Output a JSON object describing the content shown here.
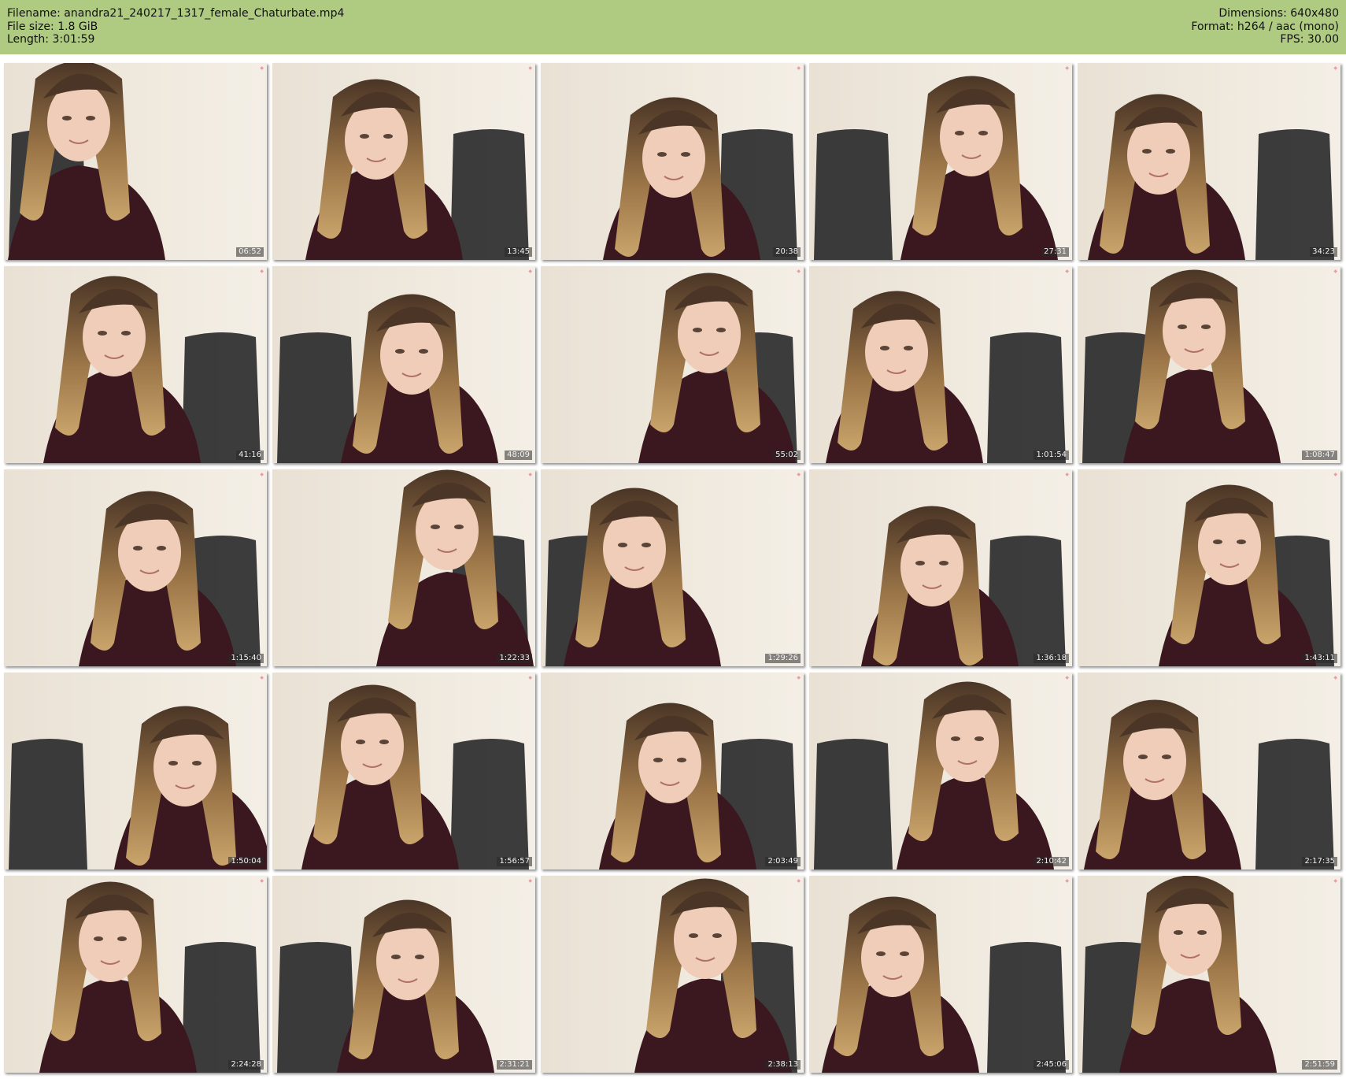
{
  "header": {
    "filename": "Filename: anandra21_240217_1317_female_Chaturbate.mp4",
    "filesize": "File size: 1.8 GiB",
    "length": "Length: 3:01:59",
    "dimensions": "Dimensions: 640x480",
    "format": "Format: h264 / aac (mono)",
    "fps": "FPS: 30.00"
  },
  "colors": {
    "header_bg": "#afcb82",
    "page_bg": "#ffffff"
  },
  "thumbnails": [
    {
      "timestamp": "06:52"
    },
    {
      "timestamp": "13:45"
    },
    {
      "timestamp": "20:38"
    },
    {
      "timestamp": "27:31"
    },
    {
      "timestamp": "34:23"
    },
    {
      "timestamp": "41:16"
    },
    {
      "timestamp": "48:09"
    },
    {
      "timestamp": "55:02"
    },
    {
      "timestamp": "1:01:54"
    },
    {
      "timestamp": "1:08:47"
    },
    {
      "timestamp": "1:15:40"
    },
    {
      "timestamp": "1:22:33"
    },
    {
      "timestamp": "1:29:26"
    },
    {
      "timestamp": "1:36:18"
    },
    {
      "timestamp": "1:43:11"
    },
    {
      "timestamp": "1:50:04"
    },
    {
      "timestamp": "1:56:57"
    },
    {
      "timestamp": "2:03:49"
    },
    {
      "timestamp": "2:10:42"
    },
    {
      "timestamp": "2:17:35"
    },
    {
      "timestamp": "2:24:28"
    },
    {
      "timestamp": "2:31:21"
    },
    {
      "timestamp": "2:38:13"
    },
    {
      "timestamp": "2:45:06"
    },
    {
      "timestamp": "2:51:59"
    }
  ]
}
